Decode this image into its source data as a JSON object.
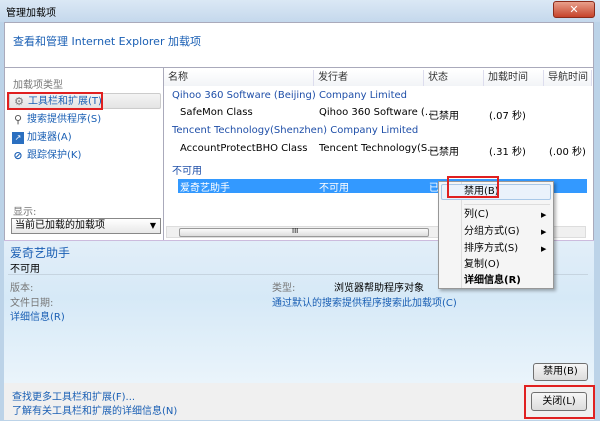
{
  "window": {
    "title": "管理加载项",
    "close_glyph": "✕"
  },
  "header": {
    "heading": "查看和管理 Internet Explorer 加载项"
  },
  "sidebar": {
    "section_label": "加载项类型",
    "items": [
      {
        "label": "工具栏和扩展(T)",
        "icon": "gear-icon"
      },
      {
        "label": "搜索提供程序(S)",
        "icon": "search-icon"
      },
      {
        "label": "加速器(A)",
        "icon": "accelerator-icon"
      },
      {
        "label": "跟踪保护(K)",
        "icon": "block-icon"
      }
    ],
    "show_label": "显示:",
    "show_value": "当前已加载的加载项"
  },
  "list": {
    "columns": [
      "名称",
      "发行者",
      "状态",
      "加载时间",
      "导航时间"
    ],
    "groups": [
      {
        "name": "Qihoo 360 Software (Beijing) Company Limited",
        "rows": [
          {
            "name": "SafeMon Class",
            "publisher": "Qihoo 360 Software (...",
            "status": "已禁用",
            "load": "(.07 秒)",
            "nav": ""
          }
        ]
      },
      {
        "name": "Tencent Technology(Shenzhen) Company Limited",
        "rows": [
          {
            "name": "AccountProtectBHO Class",
            "publisher": "Tencent Technology(S...",
            "status": "已禁用",
            "load": "(.31 秒)",
            "nav": "(.00 秒)"
          }
        ]
      },
      {
        "name": "不可用",
        "rows": [
          {
            "name": "爱奇艺助手",
            "publisher": "不可用",
            "status": "已",
            "load": "",
            "nav": ""
          }
        ]
      }
    ],
    "scroll_grip": "III"
  },
  "context_menu": {
    "items": [
      "禁用(B)",
      "列(C)",
      "分组方式(G)",
      "排序方式(S)",
      "复制(O)",
      "详细信息(R)"
    ]
  },
  "details": {
    "title": "爱奇艺助手",
    "subtitle": "不可用",
    "version_label": "版本:",
    "date_label": "文件日期:",
    "more_info": "详细信息(R)",
    "type_label": "类型:",
    "type_value": "浏览器帮助程序对象",
    "search_link": "通过默认的搜索提供程序搜索此加载项(C)",
    "disable_button": "禁用(B)"
  },
  "footer": {
    "link1": "查找更多工具栏和扩展(F)...",
    "link2": "了解有关工具栏和扩展的详细信息(N)",
    "close_button": "关闭(L)"
  }
}
